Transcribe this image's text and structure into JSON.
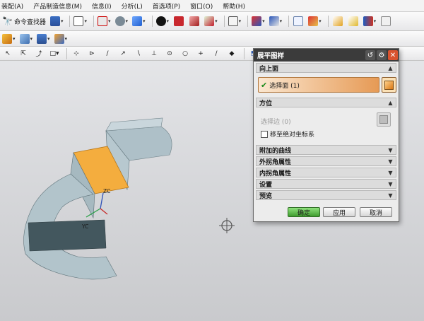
{
  "menubar": {
    "items": [
      "装配(A)",
      "产品制造信息(M)",
      "信息(I)",
      "分析(L)",
      "首选项(P)",
      "窗口(O)",
      "帮助(H)"
    ]
  },
  "toolbar": {
    "command_finder_label": "命令查找器"
  },
  "viewport": {
    "axis_zc": "ZC",
    "axis_yc": "YC",
    "colors": {
      "face_orange": "#f4ad3e",
      "face_grey": "#a8bcc4",
      "edge_dark": "#43575e"
    }
  },
  "dialog": {
    "title": "展平图样",
    "sections": {
      "up_face": {
        "header": "向上面",
        "select_label": "选择面 (1)"
      },
      "orientation": {
        "header": "方位",
        "select_edge_label": "选择边 (0)",
        "checkbox_label": "移至绝对坐标系",
        "checked": false
      },
      "collapsed": [
        "附加的曲线",
        "外拐角属性",
        "内拐角属性",
        "设置",
        "预览"
      ]
    },
    "buttons": {
      "ok": "确定",
      "apply": "应用",
      "cancel": "取消"
    }
  }
}
